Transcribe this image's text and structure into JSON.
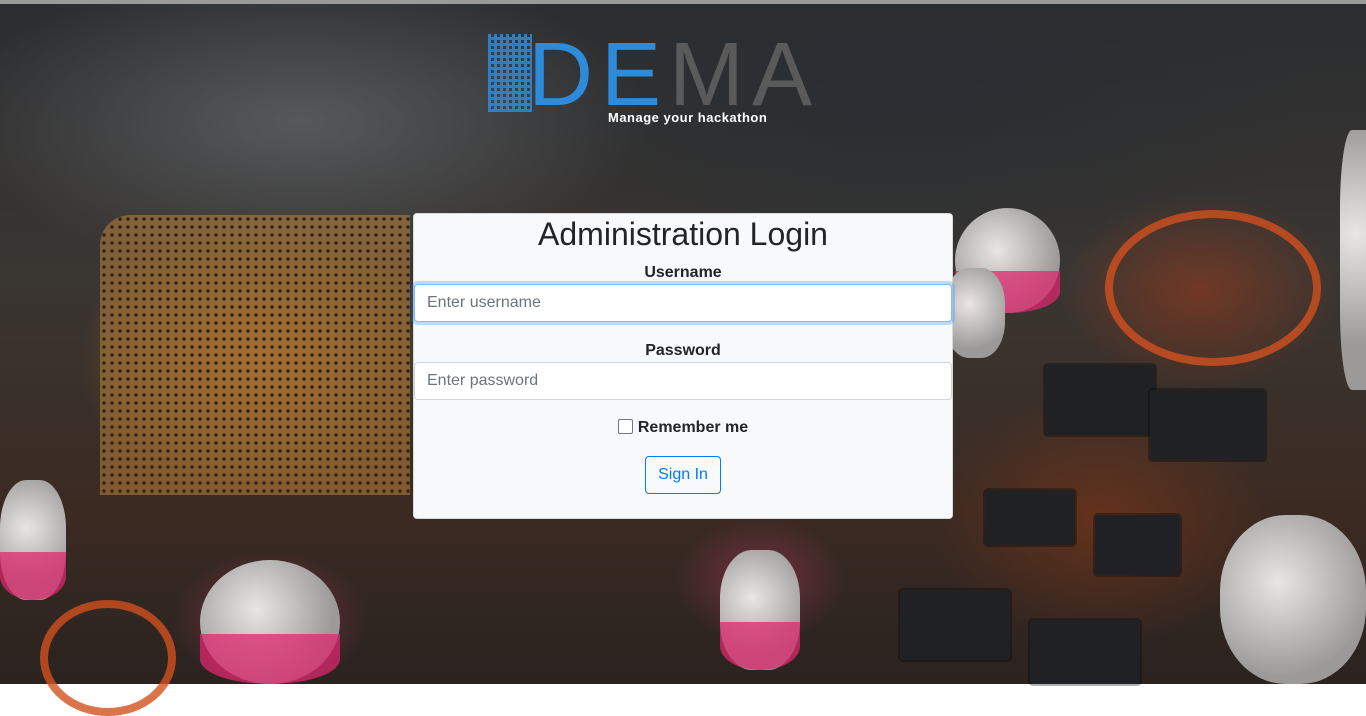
{
  "branding": {
    "logo_letters": [
      "D",
      "E",
      "M",
      "A"
    ],
    "tagline": "Manage your hackathon"
  },
  "login": {
    "title": "Administration Login",
    "username_label": "Username",
    "username_placeholder": "Enter username",
    "password_label": "Password",
    "password_placeholder": "Enter password",
    "remember_label": "Remember me",
    "submit_label": "Sign In"
  },
  "colors": {
    "brand_blue": "#2d8bdc",
    "brand_gray": "#5a5a5a",
    "accent": "#007bff"
  }
}
